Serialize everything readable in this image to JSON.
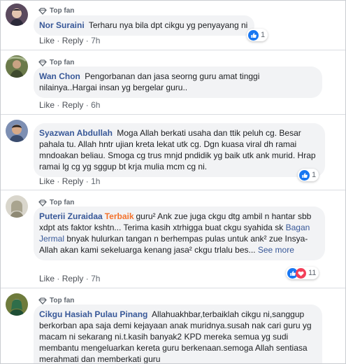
{
  "labels": {
    "top_fan": "Top fan",
    "like": "Like",
    "reply": "Reply",
    "dot": "·"
  },
  "comments": [
    {
      "name": "Nor Suraini",
      "text": "Terharu nya bila dpt cikgu yg penyayang ni",
      "time": "7h",
      "reactions": "1"
    },
    {
      "name": "Wan Chon",
      "text": "Pengorbanan dan jasa seorng guru amat tinggi nilainya..Hargai insan yg bergelar guru..",
      "time": "6h"
    },
    {
      "name": "Syazwan Abdullah",
      "text": "Moga Allah berkati usaha dan ttik peluh cg. Besar pahala tu. Allah hntr ujian kreta lekat utk cg. Dgn kuasa viral dh ramai mndoakan beliau. Smoga cg trus mnjd pndidik yg baik utk ank murid. Hrap ramai lg cg yg sggup bt krja mulia mcm cg ni.",
      "time": "1h",
      "reactions": "1"
    },
    {
      "name": "Puterii Zuraidaa",
      "badge": "Terbaik",
      "text_start": "guru² Ank zue juga ckgu dtg ambil n hantar sbb xdpt ats faktor kshtn... Terima kasih xtrhigga buat ckgu syahida sk ",
      "mention": "Bagan Jermal",
      "text_end": " bnyak hulurkan tangan n berhempas pulas untuk ank² zue Insya-Allah akan kami sekeluarga kenang jasa² ckgu trlalu bes...",
      "see_more": "See more",
      "time": "7h",
      "reactions": "11"
    },
    {
      "name": "Cikgu Hasiah Pulau Pinang",
      "text": "Allahuakhbar,terbaiklah cikgu ni,sanggup berkorban apa saja demi kejayaan anak muridnya.susah nak cari guru yg macam ni sekarang ni.t.kasih banyak2 KPD mereka semua yg sudi membantu mengeluarkan kereta guru berkenaan.semoga Allah sentiasa merahmati dan memberkati guru"
    }
  ],
  "colors": {
    "link": "#385898",
    "badge": "#f3722c",
    "bubble": "#f2f3f5",
    "like_blue": "#1877f2",
    "love_red": "#f33e58"
  }
}
